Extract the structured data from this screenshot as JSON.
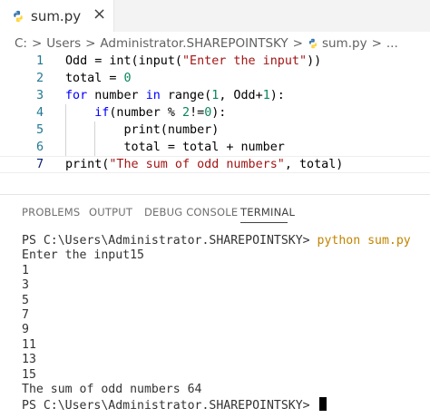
{
  "tab": {
    "filename": "sum.py",
    "close_glyph": "×"
  },
  "breadcrumb": {
    "items": [
      "C:",
      "Users",
      "Administrator.SHAREPOINTSKY",
      "sum.py",
      "..."
    ],
    "separator": ">"
  },
  "editor": {
    "lines": [
      {
        "num": "1",
        "tokens": [
          [
            "",
            "Odd = int(input("
          ],
          [
            "str",
            "\"Enter the input\""
          ],
          [
            "",
            "))"
          ]
        ]
      },
      {
        "num": "2",
        "tokens": [
          [
            "",
            "total = "
          ],
          [
            "num",
            "0"
          ]
        ]
      },
      {
        "num": "3",
        "tokens": [
          [
            "kw",
            "for"
          ],
          [
            "",
            " number "
          ],
          [
            "kw",
            "in"
          ],
          [
            "",
            " range("
          ],
          [
            "num",
            "1"
          ],
          [
            "",
            ", Odd+"
          ],
          [
            "num",
            "1"
          ],
          [
            "",
            "):"
          ]
        ]
      },
      {
        "num": "4",
        "tokens": [
          [
            "",
            "    "
          ],
          [
            "kw",
            "if"
          ],
          [
            "",
            "(number % "
          ],
          [
            "num",
            "2"
          ],
          [
            "",
            "!="
          ],
          [
            "num",
            "0"
          ],
          [
            "",
            "):"
          ]
        ]
      },
      {
        "num": "5",
        "tokens": [
          [
            "",
            "        print(number)"
          ]
        ]
      },
      {
        "num": "6",
        "tokens": [
          [
            "",
            "        total = total + number"
          ]
        ]
      },
      {
        "num": "7",
        "tokens": [
          [
            "",
            "print("
          ],
          [
            "str",
            "\"The sum of odd numbers\""
          ],
          [
            "",
            ", total)"
          ]
        ]
      }
    ]
  },
  "panel": {
    "tabs": [
      "PROBLEMS",
      "OUTPUT",
      "DEBUG CONSOLE",
      "TERMINAL"
    ],
    "active": "TERMINAL"
  },
  "terminal": {
    "prompt": "PS C:\\Users\\Administrator.SHAREPOINTSKY> ",
    "command": "python sum.py",
    "output": [
      "Enter the input15",
      "1",
      "3",
      "5",
      "7",
      "9",
      "11",
      "13",
      "15",
      "The sum of odd numbers 64"
    ],
    "final_prompt": "PS C:\\Users\\Administrator.SHAREPOINTSKY> "
  },
  "colors": {
    "keyword": "#0000ff",
    "string": "#a31515",
    "number": "#098658",
    "line_number": "#237893",
    "command": "#c18401"
  },
  "icons": [
    "python-icon",
    "close-icon"
  ]
}
